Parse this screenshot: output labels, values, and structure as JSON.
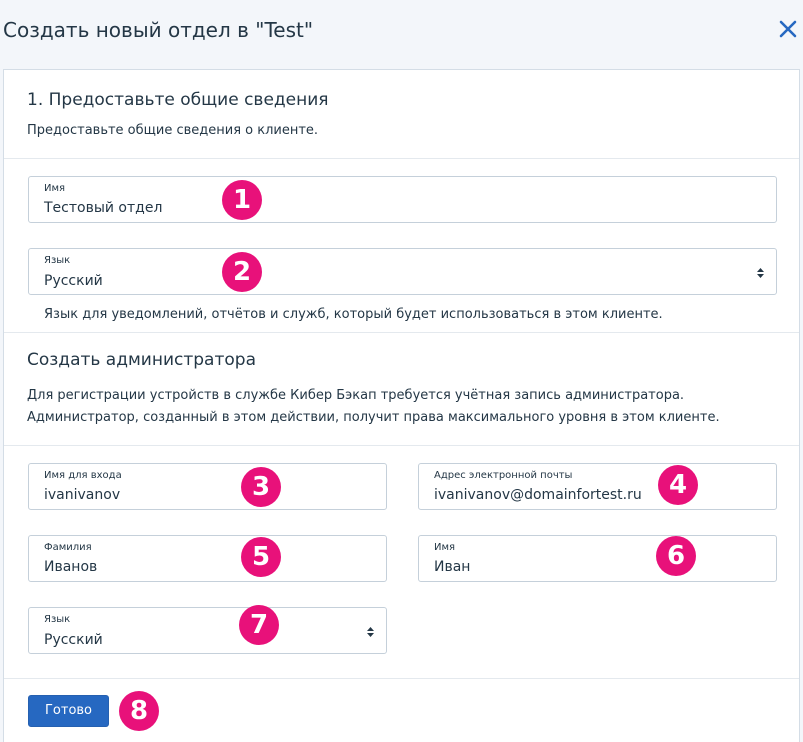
{
  "dialog": {
    "title": "Создать новый отдел в \"Test\""
  },
  "section1": {
    "heading": "1. Предоставьте общие сведения",
    "description": "Предоставьте общие сведения о клиенте."
  },
  "unit_name": {
    "label": "Имя",
    "value": "Тестовый отдел"
  },
  "unit_language": {
    "label": "Язык",
    "value": "Русский",
    "hint": "Язык для уведомлений, отчётов и служб, который будет использоваться в этом клиенте."
  },
  "admin_section": {
    "heading": "Создать администратора",
    "line1": "Для регистрации устройств в службе Кибер Бэкап требуется учётная запись администратора.",
    "line2": "Администратор, созданный в этом действии, получит права максимального уровня в этом клиенте."
  },
  "admin": {
    "login": {
      "label": "Имя для входа",
      "value": "ivanivanov"
    },
    "email": {
      "label": "Адрес электронной почты",
      "value": "ivanivanov@domainfortest.ru"
    },
    "last_name": {
      "label": "Фамилия",
      "value": "Иванов"
    },
    "first_name": {
      "label": "Имя",
      "value": "Иван"
    },
    "language": {
      "label": "Язык",
      "value": "Русский"
    }
  },
  "actions": {
    "done_label": "Готово"
  },
  "badges": [
    "1",
    "2",
    "3",
    "4",
    "5",
    "6",
    "7",
    "8"
  ],
  "colors": {
    "badge": "#e8117a",
    "primary_button": "#2668c1",
    "close_icon": "#2668c1",
    "text": "#243746",
    "background": "#f3f6fa"
  },
  "icons": {
    "close": "close-icon",
    "select": "sort-arrows-icon"
  }
}
